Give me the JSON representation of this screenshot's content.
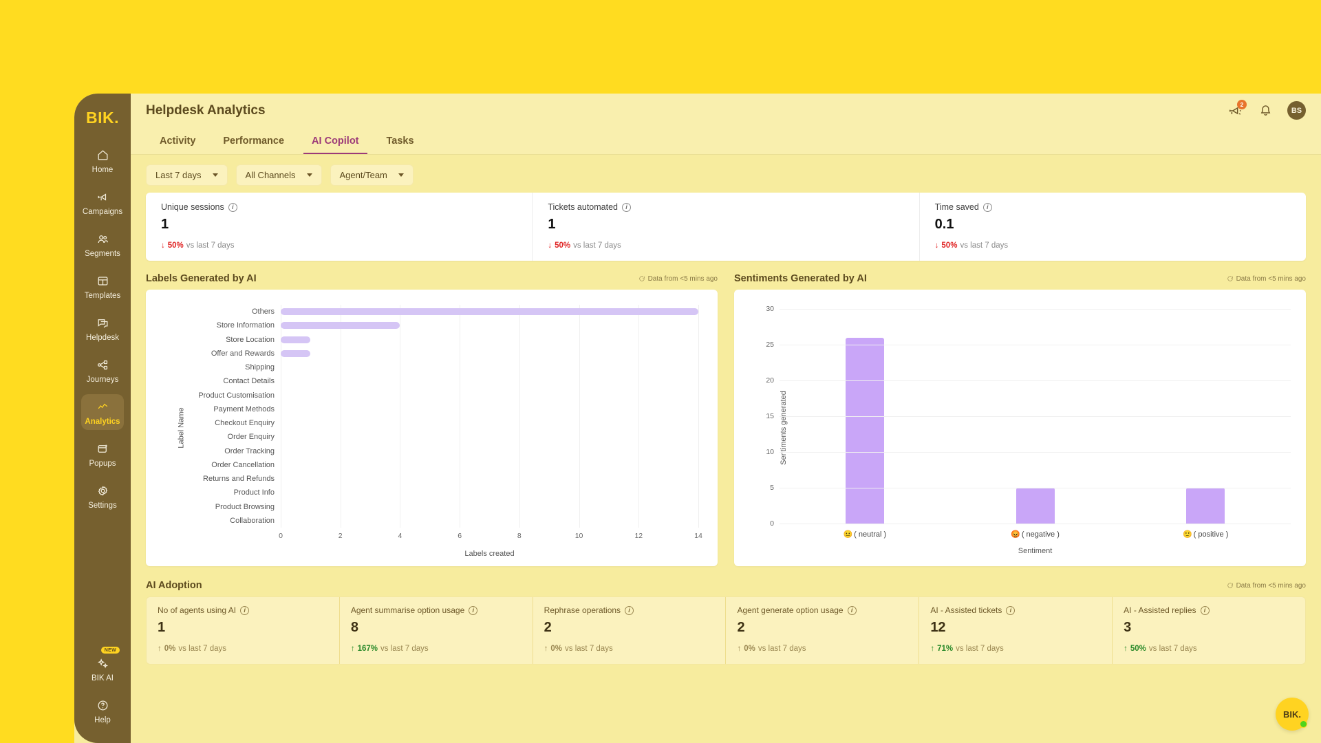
{
  "brand": "BIK.",
  "sidebar": {
    "items": [
      {
        "label": "Home",
        "icon": "home-icon"
      },
      {
        "label": "Campaigns",
        "icon": "megaphone-icon"
      },
      {
        "label": "Segments",
        "icon": "users-icon"
      },
      {
        "label": "Templates",
        "icon": "layout-icon"
      },
      {
        "label": "Helpdesk",
        "icon": "chat-icon"
      },
      {
        "label": "Journeys",
        "icon": "nodes-icon"
      },
      {
        "label": "Analytics",
        "icon": "chart-line-icon"
      },
      {
        "label": "Popups",
        "icon": "popup-icon"
      },
      {
        "label": "Settings",
        "icon": "gear-icon"
      }
    ],
    "active": "Analytics",
    "bottom": [
      {
        "label": "BIK AI",
        "icon": "sparkles-icon",
        "tag": "NEW"
      },
      {
        "label": "Help",
        "icon": "question-circle-icon"
      }
    ]
  },
  "header": {
    "title": "Helpdesk Analytics",
    "announcement_badge": "2",
    "avatar_initials": "BS"
  },
  "tabs": [
    {
      "label": "Activity",
      "active": false
    },
    {
      "label": "Performance",
      "active": false
    },
    {
      "label": "AI Copilot",
      "active": true
    },
    {
      "label": "Tasks",
      "active": false
    }
  ],
  "filters": [
    {
      "label": "Last 7 days"
    },
    {
      "label": "All Channels"
    },
    {
      "label": "Agent/Team"
    }
  ],
  "kpis": [
    {
      "label": "Unique sessions",
      "value": "1",
      "delta": "50%",
      "delta_dir": "down",
      "delta_suffix": "vs last 7 days"
    },
    {
      "label": "Tickets automated",
      "value": "1",
      "delta": "50%",
      "delta_dir": "down",
      "delta_suffix": "vs last 7 days"
    },
    {
      "label": "Time saved",
      "value": "0.1",
      "delta": "50%",
      "delta_dir": "down",
      "delta_suffix": "vs last 7 days"
    }
  ],
  "data_freshness": "Data from <5 mins ago",
  "charts": {
    "labels_title": "Labels Generated by AI",
    "sentiments_title": "Sentiments Generated by AI"
  },
  "adoption": {
    "title": "AI Adoption",
    "cards": [
      {
        "label": "No of agents using AI",
        "value": "1",
        "delta": "0%",
        "delta_dir": "up",
        "delta_suffix": "vs last 7 days",
        "muted": true
      },
      {
        "label": "Agent summarise option usage",
        "value": "8",
        "delta": "167%",
        "delta_dir": "up",
        "delta_suffix": "vs last 7 days",
        "muted": false
      },
      {
        "label": "Rephrase operations",
        "value": "2",
        "delta": "0%",
        "delta_dir": "up",
        "delta_suffix": "vs last 7 days",
        "muted": true
      },
      {
        "label": "Agent generate option usage",
        "value": "2",
        "delta": "0%",
        "delta_dir": "up",
        "delta_suffix": "vs last 7 days",
        "muted": true
      },
      {
        "label": "AI - Assisted tickets",
        "value": "12",
        "delta": "71%",
        "delta_dir": "up",
        "delta_suffix": "vs last 7 days",
        "muted": false
      },
      {
        "label": "AI - Assisted replies",
        "value": "3",
        "delta": "50%",
        "delta_dir": "up",
        "delta_suffix": "vs last 7 days",
        "muted": false
      }
    ]
  },
  "fab": {
    "label": "BIK.",
    "status": "online"
  },
  "colors": {
    "page_background": "#FFDC20",
    "sidebar": "#76602F",
    "accent_brand": "#FFD321",
    "tab_active": "#9C3A78",
    "bar_light": "#D5C5F5",
    "bar_solid": "#C9A6F8",
    "delta_down": "#E02424",
    "delta_up": "#2A8A2A"
  },
  "chart_data": [
    {
      "type": "bar",
      "orientation": "horizontal",
      "title": "Labels Generated by AI",
      "xlabel": "Labels created",
      "ylabel": "Label Name",
      "xlim": [
        0,
        14
      ],
      "xticks": [
        0,
        2,
        4,
        6,
        8,
        10,
        12,
        14
      ],
      "grid": true,
      "categories": [
        "Others",
        "Store Information",
        "Store Location",
        "Offer and Rewards",
        "Shipping",
        "Contact Details",
        "Product Customisation",
        "Payment Methods",
        "Checkout Enquiry",
        "Order Enquiry",
        "Order Tracking",
        "Order Cancellation",
        "Returns and Refunds",
        "Product Info",
        "Product Browsing",
        "Collaboration"
      ],
      "values": [
        14,
        4,
        1,
        1,
        0,
        0,
        0,
        0,
        0,
        0,
        0,
        0,
        0,
        0,
        0,
        0
      ],
      "bar_color": "#D5C5F5"
    },
    {
      "type": "bar",
      "orientation": "vertical",
      "title": "Sentiments Generated by AI",
      "xlabel": "Sentiment",
      "ylabel": "Sentiments generated",
      "ylim": [
        0,
        30
      ],
      "yticks": [
        0,
        5,
        10,
        15,
        20,
        25,
        30
      ],
      "grid": true,
      "categories": [
        "( neutral )",
        "( negative )",
        "( positive )"
      ],
      "category_emojis": [
        "😐",
        "😡",
        "🙂"
      ],
      "values": [
        26,
        5,
        5
      ],
      "bar_color": "#C9A6F8"
    }
  ]
}
